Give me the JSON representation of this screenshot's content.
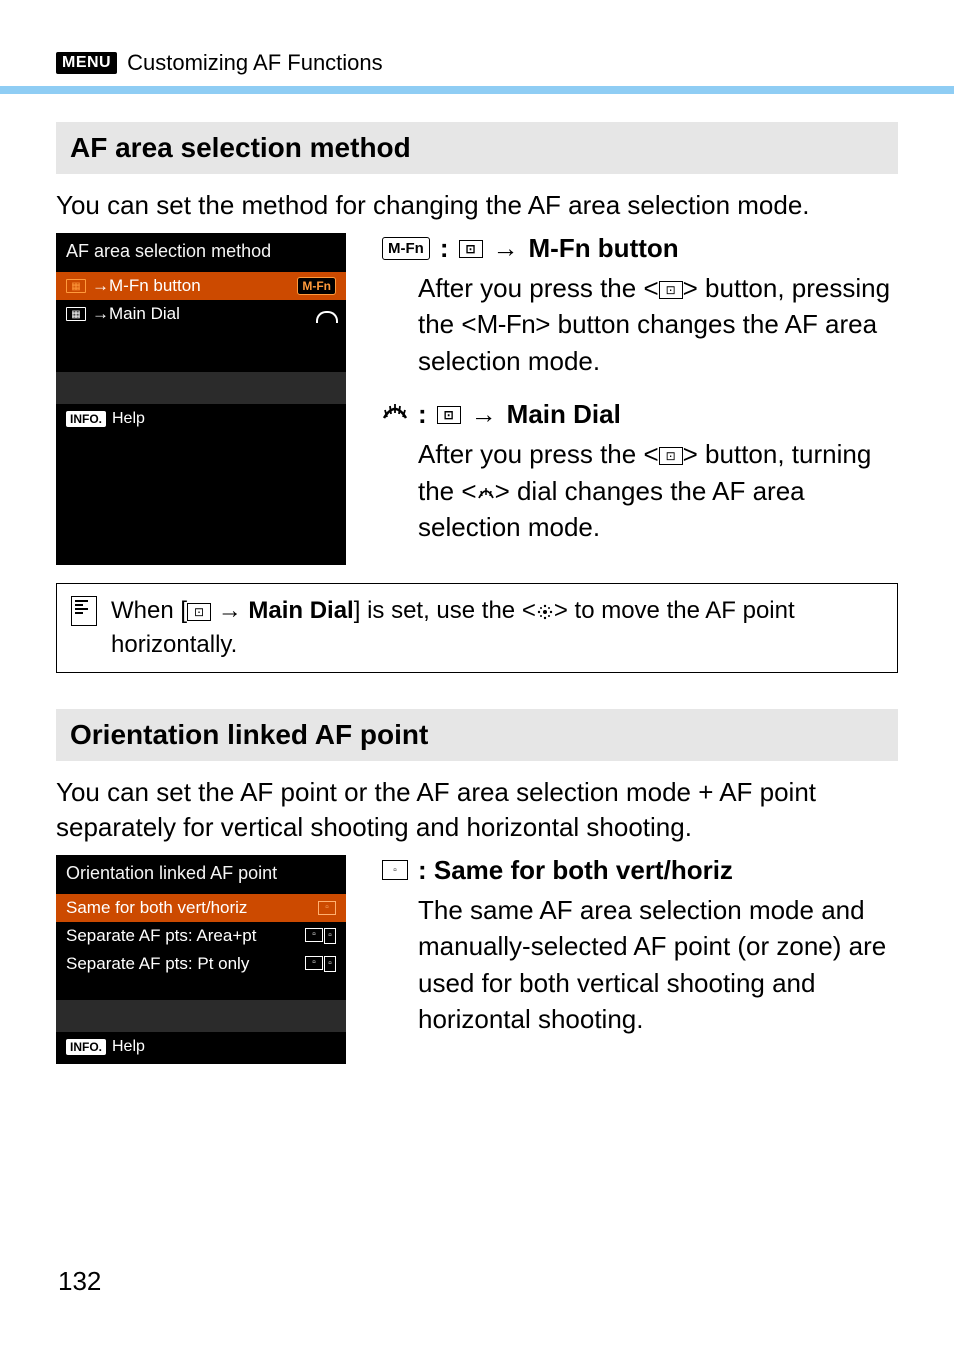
{
  "header": {
    "menu_badge": "MENU",
    "title": "Customizing AF Functions"
  },
  "section1": {
    "heading": "AF area selection method",
    "intro": "You can set the method for changing the AF area selection mode.",
    "screenshot": {
      "title": "AF area selection method",
      "row1_left": "→M-Fn button",
      "row1_right": "M-Fn",
      "row2_left": "→Main Dial",
      "footer_badge": "INFO.",
      "footer_text": "Help"
    },
    "opt1": {
      "badge": "M-Fn",
      "colon": ":",
      "arrow": "→",
      "label": "M-Fn button",
      "body_a": "After you press the <",
      "body_b": "> button, pressing the <",
      "mfn_text": "M-Fn",
      "body_c": "> button changes the AF area selection mode."
    },
    "opt2": {
      "colon": ":",
      "arrow": "→",
      "label": "Main Dial",
      "body_a": "After you press the <",
      "body_b": "> button, turning the <",
      "body_c": "> dial changes the AF area selection mode."
    },
    "note": {
      "a": "When [",
      "arrow": " → ",
      "bold": "Main Dial",
      "b": "] is set, use the <",
      "c": "> to move the AF point horizontally."
    }
  },
  "section2": {
    "heading": "Orientation linked AF point",
    "intro": "You can set the AF point or the AF area selection mode + AF point separately for vertical shooting and horizontal shooting.",
    "screenshot": {
      "title": "Orientation linked AF point",
      "row1": "Same for both vert/horiz",
      "row2": "Separate AF pts: Area+pt",
      "row3": "Separate AF pts: Pt only",
      "footer_badge": "INFO.",
      "footer_text": "Help"
    },
    "opt1": {
      "label": ": Same for both vert/horiz",
      "body": "The same AF area selection mode and manually-selected AF point (or zone) are used for both vertical shooting and horizontal shooting."
    }
  },
  "page_number": "132"
}
